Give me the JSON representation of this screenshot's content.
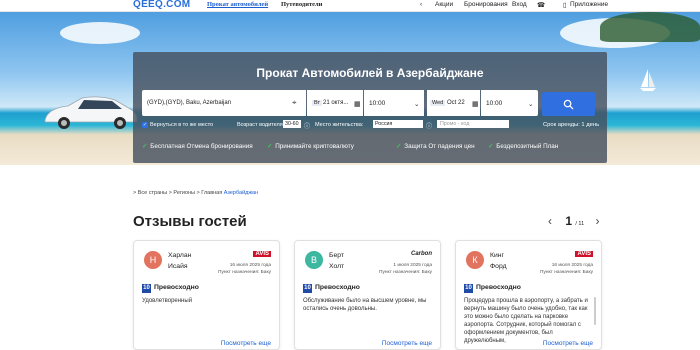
{
  "header": {
    "logo": "QEEQ.COM",
    "nav": [
      "Прокат автомобилей",
      "Путеводители"
    ],
    "right": {
      "actions": "Акции",
      "bookings": "Бронирования",
      "login": "Вход",
      "app": "Приложение"
    }
  },
  "search": {
    "title": "Прокат Автомобилей в Азербайджане",
    "location": "(GYD),(GYD), Baku, Azerbaijan",
    "pickup_day": "Вт",
    "pickup_date": "21 октя...",
    "pickup_time": "10:00",
    "return_day": "Wed",
    "return_date": "Oct 22",
    "return_time": "10:00",
    "return_same": "Вернуться в то же место",
    "age_label": "Возраст водителя:",
    "age_value": "30-60",
    "residence_label": "Место жительства:",
    "residence_value": "Россия",
    "promo_placeholder": "Промо - код",
    "rental_term": "Срок аренды: 1 день",
    "benefits": [
      "Бесплатная Отмена бронирования",
      "Принимайте криптовалюту",
      "Защита От падения цен",
      "Бездепозитный План"
    ]
  },
  "breadcrumb": {
    "prefix": "> Все страны > Регионы > Главная",
    "current": "Азербайджан"
  },
  "reviews": {
    "title": "Отзывы гостей",
    "page": "1",
    "total": "/ 11",
    "more_label": "Посмотреть еще",
    "items": [
      {
        "initial": "Н",
        "color": "#e2735e",
        "first": "Харлан",
        "last": "Исайя",
        "brand": "AVIS",
        "date": "16 июля 2025 года",
        "dest": "Пункт назначения: Баку",
        "score": "10",
        "label": "Превосходно",
        "text": "Удовлетворенный"
      },
      {
        "initial": "В",
        "color": "#3cb7a0",
        "first": "Берт",
        "last": "Холт",
        "brand": "Carbon",
        "date": "1 июля 2025 года",
        "dest": "Пункт назначения: Баку",
        "score": "10",
        "label": "Превосходно",
        "text": "Обслуживание было на высшем уровне, мы остались очень довольны."
      },
      {
        "initial": "К",
        "color": "#e2735e",
        "first": "Кинг",
        "last": "Форд",
        "brand": "AVIS",
        "date": "16 июля 2025 года",
        "dest": "Пункт назначения: Баку",
        "score": "10",
        "label": "Превосходно",
        "text": "Процедура прошла в аэропорту, а забрать и вернуть машину было очень удобно, так как это можно было сделать на парковке аэропорта. Сотрудник, который помогал с оформлением документов, был дружелюбным,"
      }
    ]
  }
}
